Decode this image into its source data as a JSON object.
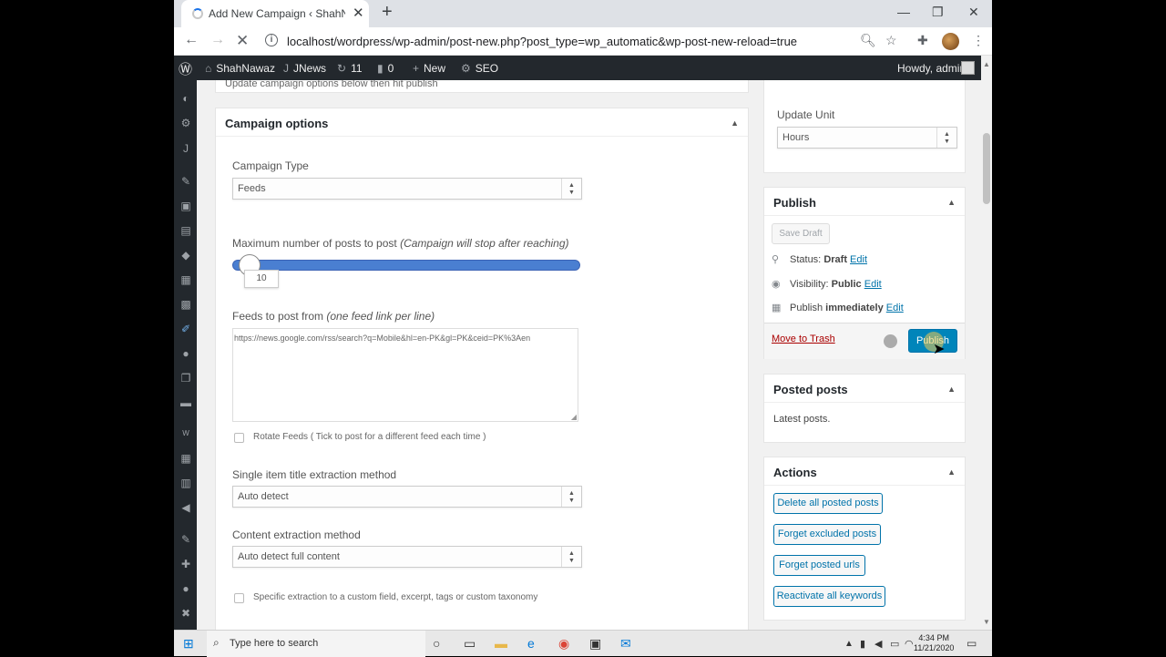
{
  "browser": {
    "tab_title": "Add New Campaign ‹ ShahNawaz",
    "url": "localhost/wordpress/wp-admin/post-new.php?post_type=wp_automatic&wp-post-new-reload=true"
  },
  "adminbar": {
    "site": "ShahNawaz",
    "theme": "JNews",
    "updates": "11",
    "comments": "0",
    "new": "New",
    "seo": "SEO",
    "howdy": "Howdy, admin"
  },
  "main": {
    "top_note": "Update campaign options below then hit publish",
    "campaign_options": {
      "title": "Campaign options",
      "campaign_type_label": "Campaign Type",
      "campaign_type_value": "Feeds",
      "max_posts_label": "Maximum number of posts to post",
      "max_posts_note": "(Campaign will stop after reaching)",
      "max_posts_value": "10",
      "max_posts_slider_fraction": 0.02,
      "feeds_label": "Feeds to post from",
      "feeds_note": "(one feed link per line)",
      "feeds_value": "https://news.google.com/rss/search?q=Mobile&hl=en-PK&gl=PK&ceid=PK%3Aen",
      "rotate_label": "Rotate Feeds ( Tick to post for a different feed each time )",
      "title_method_label": "Single item title extraction method",
      "title_method_value": "Auto detect",
      "content_method_label": "Content extraction method",
      "content_method_value": "Auto detect full content",
      "specific_label": "Specific extraction to a custom field, excerpt, tags or custom taxonomy"
    }
  },
  "side": {
    "update_unit_label": "Update Unit",
    "update_unit_value": "Hours",
    "publish": {
      "title": "Publish",
      "save_draft": "Save Draft",
      "status_label": "Status:",
      "status_value": "Draft",
      "visibility_label": "Visibility:",
      "visibility_value": "Public",
      "publish_label": "Publish",
      "publish_value": "immediately",
      "edit": "Edit",
      "move_to_trash": "Move to Trash",
      "publish_button": "Publish"
    },
    "posted_posts": {
      "title": "Posted posts",
      "text": "Latest posts."
    },
    "actions": {
      "title": "Actions",
      "buttons": [
        "Delete all posted posts",
        "Forget excluded posts",
        "Forget posted urls",
        "Reactivate all keywords"
      ]
    }
  },
  "taskbar": {
    "search_placeholder": "Type here to search",
    "time": "4:34 PM",
    "date": "11/21/2020"
  },
  "colors": {
    "accent": "#0073aa",
    "publish_button": "#0085ba",
    "adminbar": "#23282d",
    "slider_fill": "#4a7fd1"
  }
}
